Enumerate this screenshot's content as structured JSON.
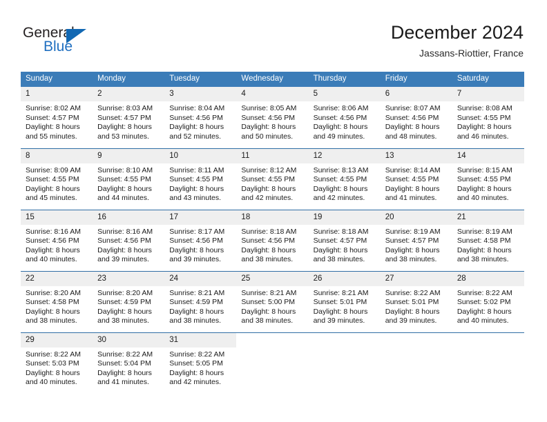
{
  "brand": {
    "name_top": "General",
    "name_bottom": "Blue",
    "flag_icon": "triangle-flag-icon",
    "color_top": "#231f20",
    "color_bottom": "#1f6fc0",
    "flag_color": "#1268b3"
  },
  "header": {
    "title": "December 2024",
    "subtitle": "Jassans-Riottier, France"
  },
  "theme": {
    "header_bg": "#3b7cb8",
    "row_divider": "#2e6da4",
    "daynum_bg": "#efefef",
    "text": "#1a1a1a",
    "page_bg": "#ffffff"
  },
  "calendar": {
    "weekday_headers": [
      "Sunday",
      "Monday",
      "Tuesday",
      "Wednesday",
      "Thursday",
      "Friday",
      "Saturday"
    ],
    "weeks": [
      [
        {
          "day": "1",
          "sunrise": "Sunrise: 8:02 AM",
          "sunset": "Sunset: 4:57 PM",
          "daylight": "Daylight: 8 hours and 55 minutes."
        },
        {
          "day": "2",
          "sunrise": "Sunrise: 8:03 AM",
          "sunset": "Sunset: 4:57 PM",
          "daylight": "Daylight: 8 hours and 53 minutes."
        },
        {
          "day": "3",
          "sunrise": "Sunrise: 8:04 AM",
          "sunset": "Sunset: 4:56 PM",
          "daylight": "Daylight: 8 hours and 52 minutes."
        },
        {
          "day": "4",
          "sunrise": "Sunrise: 8:05 AM",
          "sunset": "Sunset: 4:56 PM",
          "daylight": "Daylight: 8 hours and 50 minutes."
        },
        {
          "day": "5",
          "sunrise": "Sunrise: 8:06 AM",
          "sunset": "Sunset: 4:56 PM",
          "daylight": "Daylight: 8 hours and 49 minutes."
        },
        {
          "day": "6",
          "sunrise": "Sunrise: 8:07 AM",
          "sunset": "Sunset: 4:56 PM",
          "daylight": "Daylight: 8 hours and 48 minutes."
        },
        {
          "day": "7",
          "sunrise": "Sunrise: 8:08 AM",
          "sunset": "Sunset: 4:55 PM",
          "daylight": "Daylight: 8 hours and 46 minutes."
        }
      ],
      [
        {
          "day": "8",
          "sunrise": "Sunrise: 8:09 AM",
          "sunset": "Sunset: 4:55 PM",
          "daylight": "Daylight: 8 hours and 45 minutes."
        },
        {
          "day": "9",
          "sunrise": "Sunrise: 8:10 AM",
          "sunset": "Sunset: 4:55 PM",
          "daylight": "Daylight: 8 hours and 44 minutes."
        },
        {
          "day": "10",
          "sunrise": "Sunrise: 8:11 AM",
          "sunset": "Sunset: 4:55 PM",
          "daylight": "Daylight: 8 hours and 43 minutes."
        },
        {
          "day": "11",
          "sunrise": "Sunrise: 8:12 AM",
          "sunset": "Sunset: 4:55 PM",
          "daylight": "Daylight: 8 hours and 42 minutes."
        },
        {
          "day": "12",
          "sunrise": "Sunrise: 8:13 AM",
          "sunset": "Sunset: 4:55 PM",
          "daylight": "Daylight: 8 hours and 42 minutes."
        },
        {
          "day": "13",
          "sunrise": "Sunrise: 8:14 AM",
          "sunset": "Sunset: 4:55 PM",
          "daylight": "Daylight: 8 hours and 41 minutes."
        },
        {
          "day": "14",
          "sunrise": "Sunrise: 8:15 AM",
          "sunset": "Sunset: 4:55 PM",
          "daylight": "Daylight: 8 hours and 40 minutes."
        }
      ],
      [
        {
          "day": "15",
          "sunrise": "Sunrise: 8:16 AM",
          "sunset": "Sunset: 4:56 PM",
          "daylight": "Daylight: 8 hours and 40 minutes."
        },
        {
          "day": "16",
          "sunrise": "Sunrise: 8:16 AM",
          "sunset": "Sunset: 4:56 PM",
          "daylight": "Daylight: 8 hours and 39 minutes."
        },
        {
          "day": "17",
          "sunrise": "Sunrise: 8:17 AM",
          "sunset": "Sunset: 4:56 PM",
          "daylight": "Daylight: 8 hours and 39 minutes."
        },
        {
          "day": "18",
          "sunrise": "Sunrise: 8:18 AM",
          "sunset": "Sunset: 4:56 PM",
          "daylight": "Daylight: 8 hours and 38 minutes."
        },
        {
          "day": "19",
          "sunrise": "Sunrise: 8:18 AM",
          "sunset": "Sunset: 4:57 PM",
          "daylight": "Daylight: 8 hours and 38 minutes."
        },
        {
          "day": "20",
          "sunrise": "Sunrise: 8:19 AM",
          "sunset": "Sunset: 4:57 PM",
          "daylight": "Daylight: 8 hours and 38 minutes."
        },
        {
          "day": "21",
          "sunrise": "Sunrise: 8:19 AM",
          "sunset": "Sunset: 4:58 PM",
          "daylight": "Daylight: 8 hours and 38 minutes."
        }
      ],
      [
        {
          "day": "22",
          "sunrise": "Sunrise: 8:20 AM",
          "sunset": "Sunset: 4:58 PM",
          "daylight": "Daylight: 8 hours and 38 minutes."
        },
        {
          "day": "23",
          "sunrise": "Sunrise: 8:20 AM",
          "sunset": "Sunset: 4:59 PM",
          "daylight": "Daylight: 8 hours and 38 minutes."
        },
        {
          "day": "24",
          "sunrise": "Sunrise: 8:21 AM",
          "sunset": "Sunset: 4:59 PM",
          "daylight": "Daylight: 8 hours and 38 minutes."
        },
        {
          "day": "25",
          "sunrise": "Sunrise: 8:21 AM",
          "sunset": "Sunset: 5:00 PM",
          "daylight": "Daylight: 8 hours and 38 minutes."
        },
        {
          "day": "26",
          "sunrise": "Sunrise: 8:21 AM",
          "sunset": "Sunset: 5:01 PM",
          "daylight": "Daylight: 8 hours and 39 minutes."
        },
        {
          "day": "27",
          "sunrise": "Sunrise: 8:22 AM",
          "sunset": "Sunset: 5:01 PM",
          "daylight": "Daylight: 8 hours and 39 minutes."
        },
        {
          "day": "28",
          "sunrise": "Sunrise: 8:22 AM",
          "sunset": "Sunset: 5:02 PM",
          "daylight": "Daylight: 8 hours and 40 minutes."
        }
      ],
      [
        {
          "day": "29",
          "sunrise": "Sunrise: 8:22 AM",
          "sunset": "Sunset: 5:03 PM",
          "daylight": "Daylight: 8 hours and 40 minutes."
        },
        {
          "day": "30",
          "sunrise": "Sunrise: 8:22 AM",
          "sunset": "Sunset: 5:04 PM",
          "daylight": "Daylight: 8 hours and 41 minutes."
        },
        {
          "day": "31",
          "sunrise": "Sunrise: 8:22 AM",
          "sunset": "Sunset: 5:05 PM",
          "daylight": "Daylight: 8 hours and 42 minutes."
        },
        {
          "day": "",
          "sunrise": "",
          "sunset": "",
          "daylight": ""
        },
        {
          "day": "",
          "sunrise": "",
          "sunset": "",
          "daylight": ""
        },
        {
          "day": "",
          "sunrise": "",
          "sunset": "",
          "daylight": ""
        },
        {
          "day": "",
          "sunrise": "",
          "sunset": "",
          "daylight": ""
        }
      ]
    ]
  }
}
